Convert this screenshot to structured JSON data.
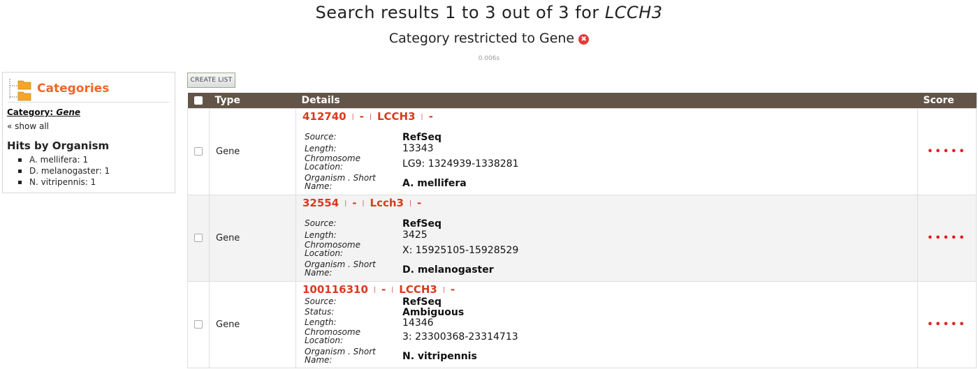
{
  "header": {
    "title_prefix": "Search results 1 to 3 out of 3 for ",
    "query": "LCCH3",
    "subtitle": "Category restricted to Gene",
    "remove_icon": "✖",
    "timing": "0.006s"
  },
  "sidebar": {
    "title": "Categories",
    "category_label": "Category: ",
    "category_value": "Gene",
    "show_all": "« show all",
    "hits_title": "Hits by Organism",
    "organisms": [
      "A. mellifera: 1",
      "D. melanogaster: 1",
      "N. vitripennis: 1"
    ]
  },
  "toolbar": {
    "create_list": "CREATE LIST"
  },
  "table": {
    "columns": {
      "type": "Type",
      "details": "Details",
      "score": "Score"
    },
    "rows": [
      {
        "type": "Gene",
        "id": "412740",
        "dash1": "-",
        "symbol": "LCCH3",
        "dash2": "-",
        "fields": {
          "source_label": "Source:",
          "source": "RefSeq",
          "length_label": "Length:",
          "length": "13343",
          "chrom_label_1": "Chromosome",
          "chrom_label_2": "Location:",
          "chrom": "LG9: 1324939-1338281",
          "org_label_1": "Organism . Short",
          "org_label_2": "Name:",
          "org": "A. mellifera"
        },
        "score": "•••••"
      },
      {
        "type": "Gene",
        "id": "32554",
        "dash1": "-",
        "symbol": "Lcch3",
        "dash2": "-",
        "fields": {
          "source_label": "Source:",
          "source": "RefSeq",
          "length_label": "Length:",
          "length": "3425",
          "chrom_label_1": "Chromosome",
          "chrom_label_2": "Location:",
          "chrom": "X: 15925105-15928529",
          "org_label_1": "Organism . Short",
          "org_label_2": "Name:",
          "org": "D. melanogaster"
        },
        "score": "•••••"
      },
      {
        "type": "Gene",
        "id": "100116310",
        "dash1": "-",
        "symbol": "LCCH3",
        "dash2": "-",
        "fields": {
          "source_label": "Source:",
          "source": "RefSeq",
          "status_label": "Status:",
          "status": "Ambiguous",
          "length_label": "Length:",
          "length": "14346",
          "chrom_label_1": "Chromosome",
          "chrom_label_2": "Location:",
          "chrom": "3: 23300368-23314713",
          "org_label_1": "Organism . Short",
          "org_label_2": "Name:",
          "org": "N. vitripennis"
        },
        "score": "•••••"
      }
    ]
  },
  "colors": {
    "accent": "#f0662a",
    "link_red": "#d93a1f",
    "header_bg": "#625548"
  }
}
